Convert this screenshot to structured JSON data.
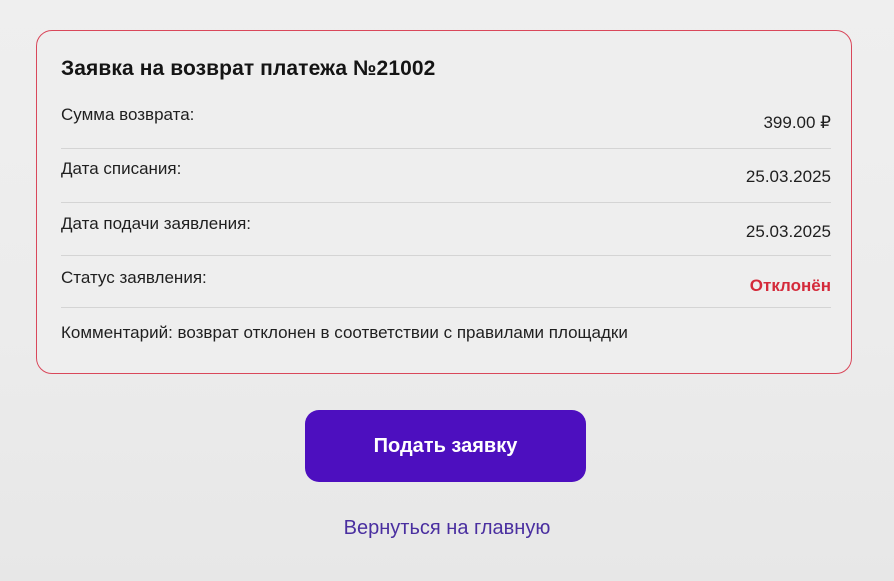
{
  "refund_request": {
    "title": "Заявка на возврат платежа №21002",
    "rows": [
      {
        "label": "Сумма возврата:",
        "value": "399.00 ₽"
      },
      {
        "label": "Дата списания:",
        "value": "25.03.2025"
      },
      {
        "label": "Дата подачи заявления:",
        "value": "25.03.2025"
      },
      {
        "label": "Статус заявления:",
        "value": "Отклонён"
      }
    ],
    "comment": "Комментарий: возврат отклонен в соответствии с правилами площадки",
    "status_color": "#d42a3a",
    "border_color": "#d9475a"
  },
  "actions": {
    "submit_label": "Подать заявку",
    "submit_color": "#4d0fbf",
    "home_link_label": "Вернуться на главную"
  }
}
